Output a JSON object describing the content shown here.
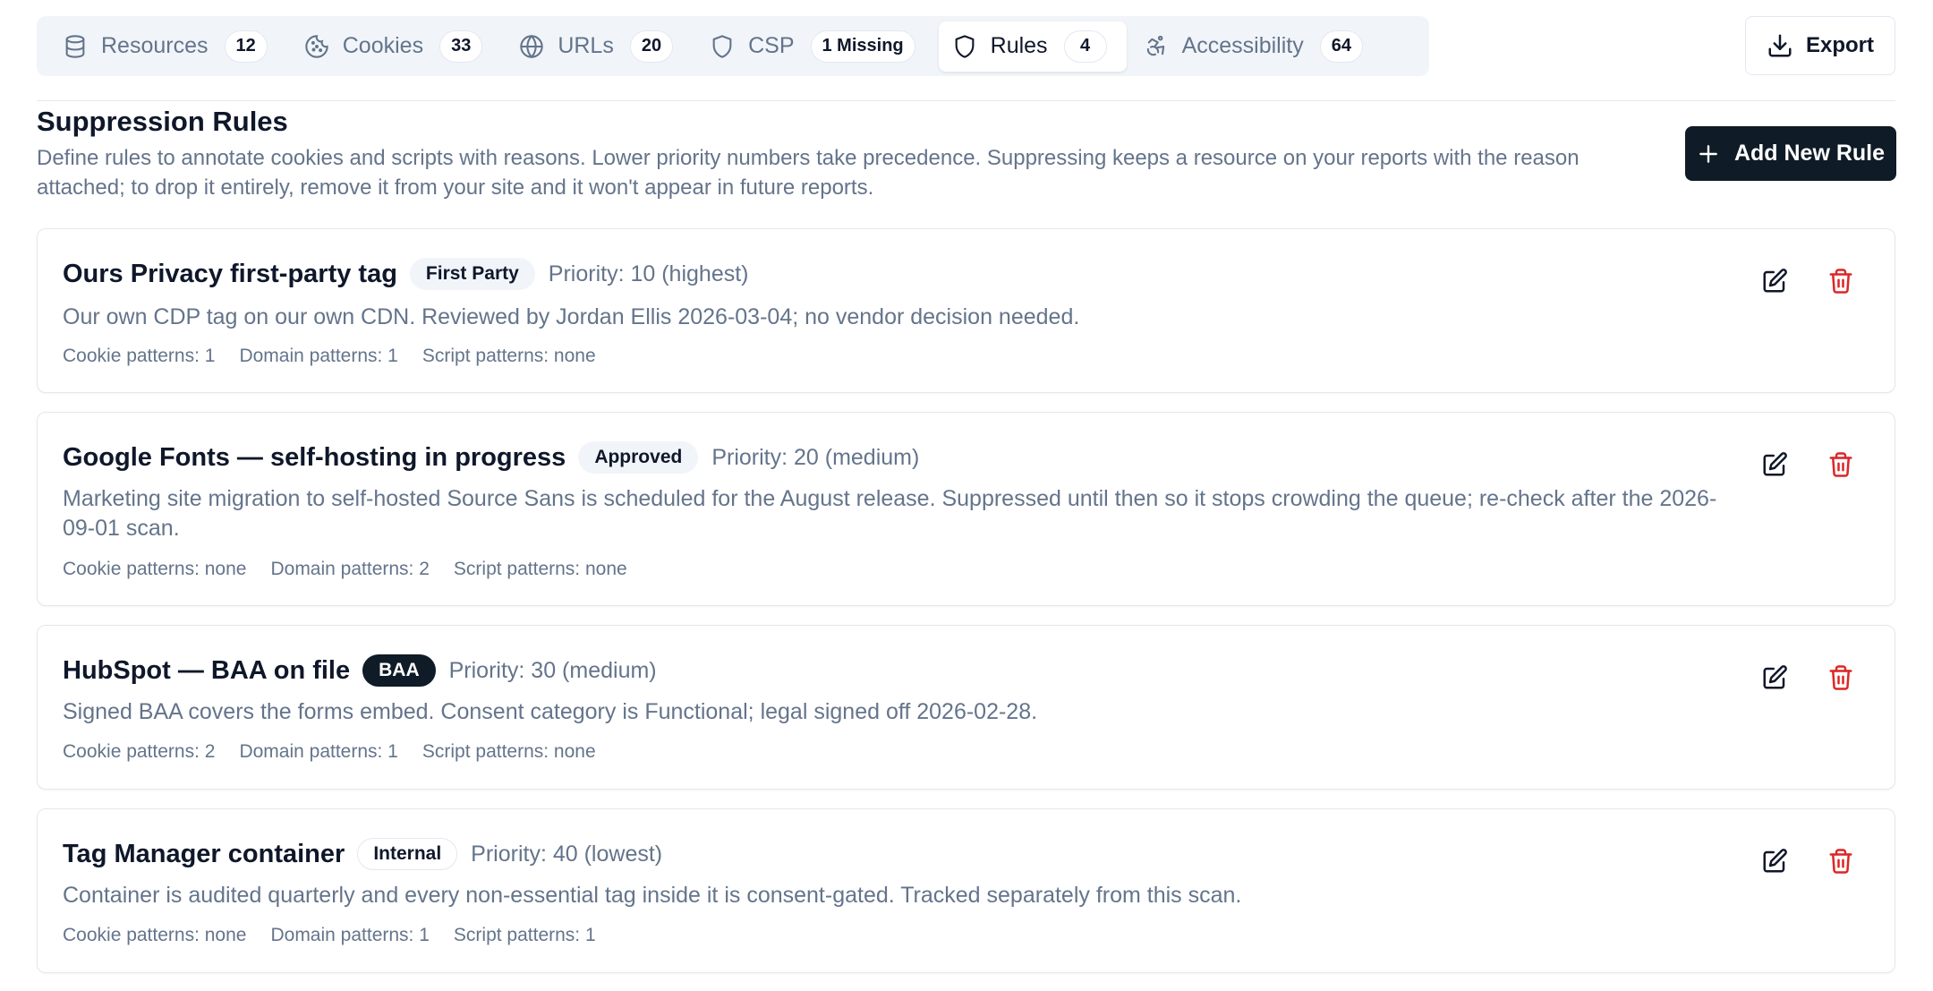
{
  "tabs": [
    {
      "label": "Resources",
      "count": "12",
      "icon": "database-icon"
    },
    {
      "label": "Cookies",
      "count": "33",
      "icon": "cookie-icon"
    },
    {
      "label": "URLs",
      "count": "20",
      "icon": "globe-icon"
    },
    {
      "label": "CSP",
      "count": "1 Missing",
      "icon": "shield-icon"
    },
    {
      "label": "Rules",
      "count": "4",
      "icon": "shield-icon",
      "active": true
    },
    {
      "label": "Accessibility",
      "count": "64",
      "icon": "accessibility-icon"
    }
  ],
  "toolbar": {
    "export_label": "Export"
  },
  "page": {
    "title": "Suppression Rules",
    "subtitle": "Define rules to annotate cookies and scripts with reasons. Lower priority numbers take precedence. Suppressing keeps a resource on your reports with the reason attached; to drop it entirely, remove it from your site and it won't appear in future reports.",
    "add_rule_label": "Add New Rule"
  },
  "rules": [
    {
      "title": "Ours Privacy first-party tag",
      "badge": "First Party",
      "priority": "Priority: 10 (highest)",
      "description": "Our own CDP tag on our own CDN. Reviewed by Jordan Ellis 2026-03-04; no vendor decision needed.",
      "cookie_patterns": "Cookie patterns: 1",
      "domain_patterns": "Domain patterns: 1",
      "script_patterns": "Script patterns: none"
    },
    {
      "title": "Google Fonts — self-hosting in progress",
      "badge": "Approved",
      "priority": "Priority: 20 (medium)",
      "description": "Marketing site migration to self-hosted Source Sans is scheduled for the August release. Suppressed until then so it stops crowding the queue; re-check after the 2026-09-01 scan.",
      "cookie_patterns": "Cookie patterns: none",
      "domain_patterns": "Domain patterns: 2",
      "script_patterns": "Script patterns: none"
    },
    {
      "title": "HubSpot — BAA on file",
      "badge": "BAA",
      "priority": "Priority: 30 (medium)",
      "description": "Signed BAA covers the forms embed. Consent category is Functional; legal signed off 2026-02-28.",
      "cookie_patterns": "Cookie patterns: 2",
      "domain_patterns": "Domain patterns: 1",
      "script_patterns": "Script patterns: none"
    },
    {
      "title": "Tag Manager container",
      "badge": "Internal",
      "priority": "Priority: 40 (lowest)",
      "description": "Container is audited quarterly and every non-essential tag inside it is consent-gated. Tracked separately from this scan.",
      "cookie_patterns": "Cookie patterns: none",
      "domain_patterns": "Domain patterns: 1",
      "script_patterns": "Script patterns: 1"
    }
  ],
  "colors": {
    "accent_dark": "#0f1b26",
    "danger": "#dc2626",
    "muted_text": "#64748b",
    "tab_bar_bg": "#f1f5f9"
  }
}
